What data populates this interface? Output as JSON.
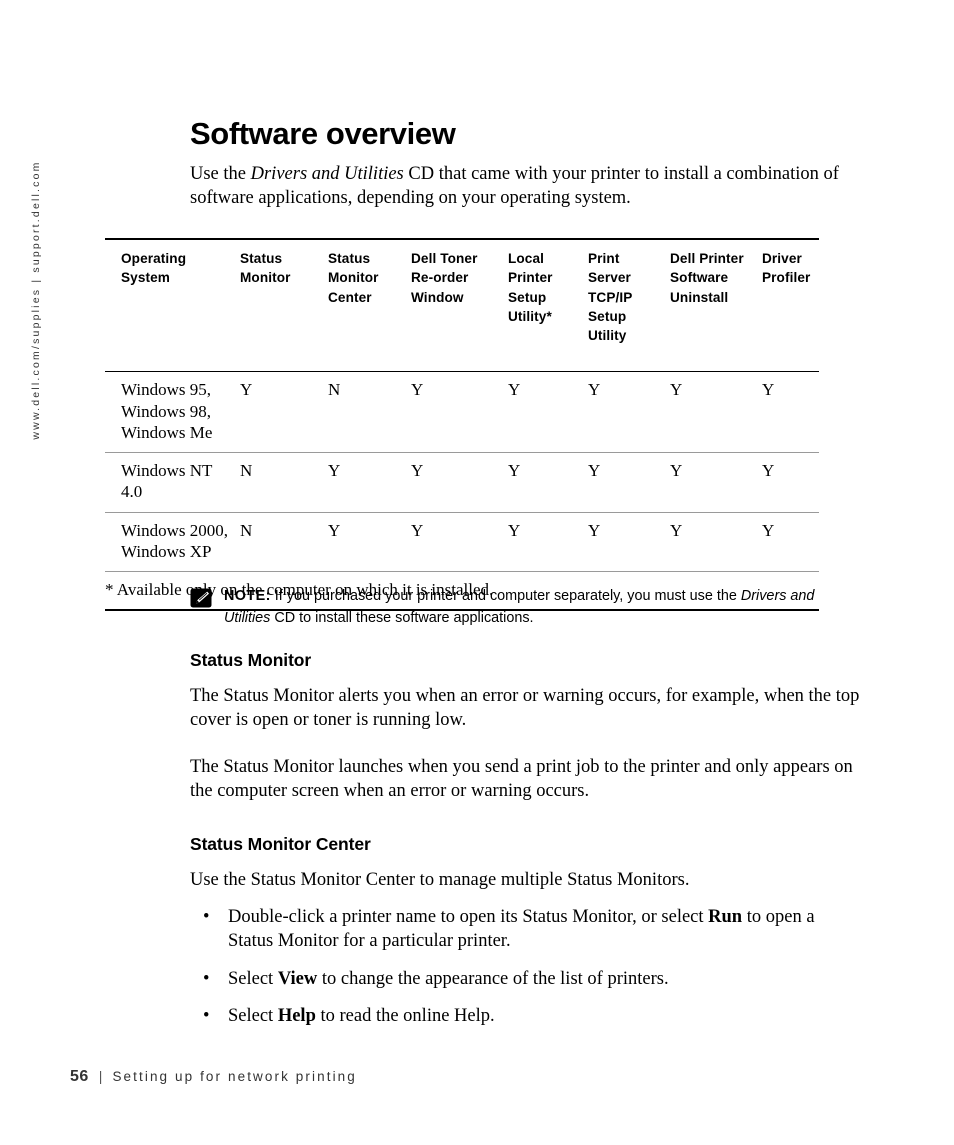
{
  "side_rail": {
    "text": "www.dell.com/supplies  |  support.dell.com"
  },
  "page": {
    "title": "Software overview",
    "intro_before": "Use the ",
    "intro_italic": "Drivers and Utilities",
    "intro_after": " CD that came with your printer to install a combination of software applications, depending on your operating system."
  },
  "table": {
    "columns": [
      "Operating System",
      "Status Monitor",
      "Status Monitor Center",
      "Dell Toner Re-order Window",
      "Local Printer Setup Utility*",
      "Print Server TCP/IP Setup Utility",
      "Dell Printer Software Uninstall",
      "Driver Profiler"
    ],
    "rows": [
      {
        "os": "Windows 95, Windows 98, Windows Me",
        "values": [
          "Y",
          "N",
          "Y",
          "Y",
          "Y",
          "Y",
          "Y"
        ]
      },
      {
        "os": "Windows NT 4.0",
        "values": [
          "N",
          "Y",
          "Y",
          "Y",
          "Y",
          "Y",
          "Y"
        ]
      },
      {
        "os": "Windows 2000, Windows XP",
        "values": [
          "N",
          "Y",
          "Y",
          "Y",
          "Y",
          "Y",
          "Y"
        ]
      }
    ],
    "footnote": "* Available only on the computer on which it is installed."
  },
  "note": {
    "icon": "note-pencil-icon",
    "label": "NOTE:",
    "text_before": " If you purchased your printer and computer separately, you must use the ",
    "italic_1": "Drivers and Utilities",
    "text_after": " CD to install these software applications."
  },
  "sections": [
    {
      "heading": "Status Monitor",
      "paragraphs": [
        "The Status Monitor alerts you when an error or warning occurs, for example, when the top cover is open or toner is running low.",
        "The Status Monitor launches when you send a print job to the printer and only appears on the computer screen when an error or warning occurs."
      ]
    },
    {
      "heading": "Status Monitor Center",
      "paragraphs": [
        "Use the Status Monitor Center to manage multiple Status Monitors."
      ]
    }
  ],
  "bullets": [
    {
      "marker": "•",
      "before": "Double-click a printer name to open its Status Monitor, or select ",
      "bold": "Run",
      "after": " to open a Status Monitor for a particular printer."
    },
    {
      "marker": "•",
      "before": "Select ",
      "bold": "View",
      "after": " to change the appearance of the list of printers."
    },
    {
      "marker": "•",
      "before": "Select ",
      "bold": "Help",
      "after": " to read the online Help."
    }
  ],
  "footer": {
    "page_number": "56",
    "separator": "|",
    "label": "Setting up for network printing"
  }
}
